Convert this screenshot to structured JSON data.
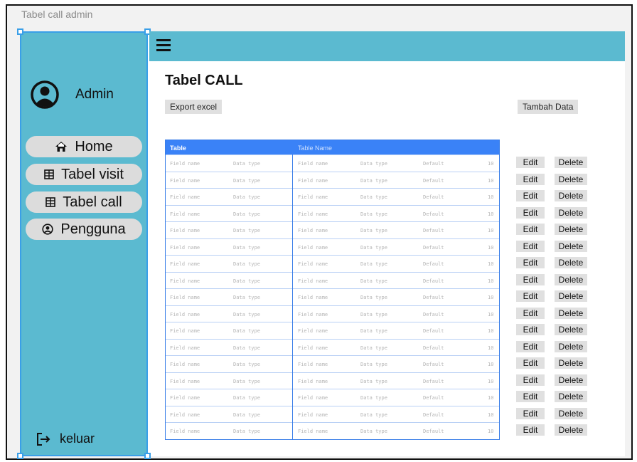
{
  "frame": {
    "title": "Tabel call admin"
  },
  "sidebar": {
    "profile_label": "Admin",
    "items": [
      {
        "label": "Home",
        "icon": "home-icon"
      },
      {
        "label": "Tabel visit",
        "icon": "table-icon"
      },
      {
        "label": "Tabel call",
        "icon": "table-icon"
      },
      {
        "label": "Pengguna",
        "icon": "user-circle-icon"
      }
    ],
    "logout_label": "keluar"
  },
  "header": {
    "menu_icon": "hamburger-icon"
  },
  "main": {
    "title": "Tabel CALL",
    "export_label": "Export excel",
    "add_label": "Tambah Data",
    "table": {
      "left_header": "Table",
      "right_header": "Table Name",
      "cells": [
        "Field name",
        "Data type",
        "Field name",
        "Data type",
        "Default",
        "10"
      ],
      "row_count": 17
    },
    "actions": {
      "edit_label": "Edit",
      "delete_label": "Delete"
    }
  },
  "colors": {
    "sidebar": "#5bbad0",
    "topbar": "#5bbad0",
    "table_header": "#3a82f7",
    "button": "#e0e0e0"
  }
}
